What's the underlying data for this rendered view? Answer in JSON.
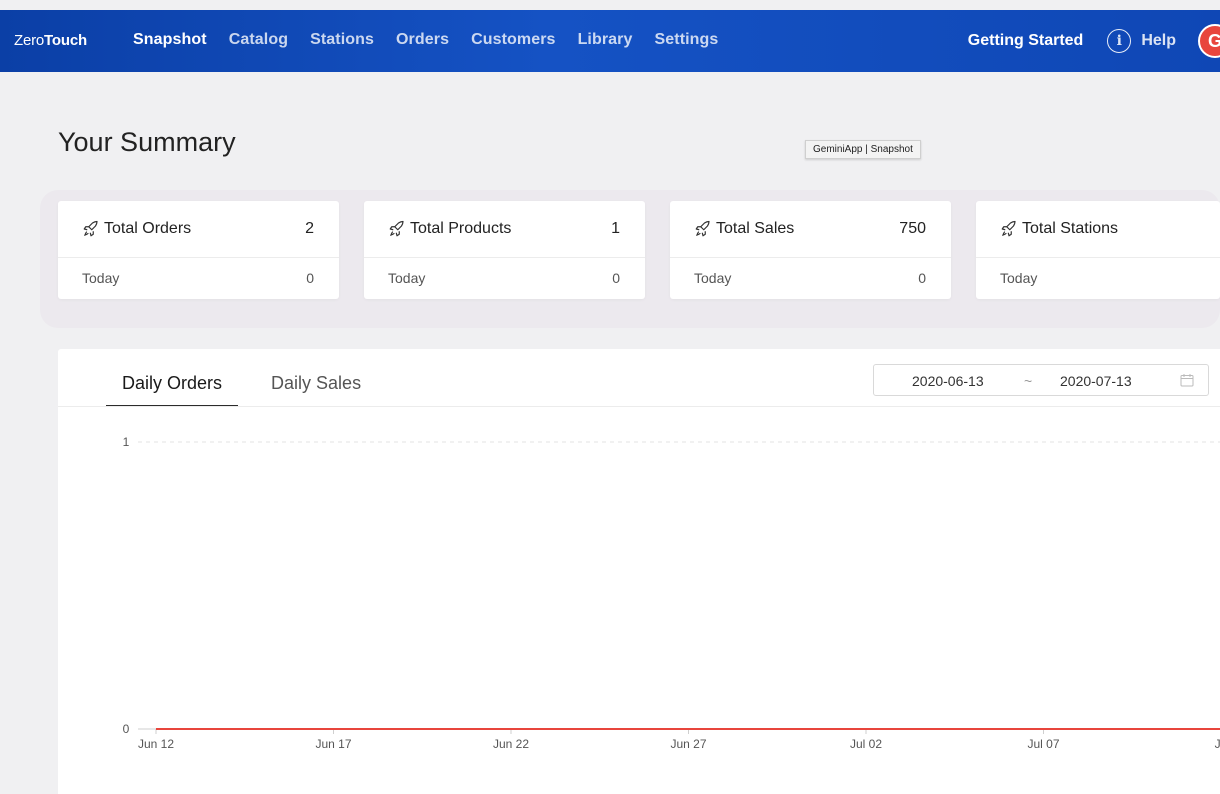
{
  "brand": {
    "part1": "Zero",
    "part2": "Touch"
  },
  "nav": {
    "items": [
      "Snapshot",
      "Catalog",
      "Stations",
      "Orders",
      "Customers",
      "Library",
      "Settings"
    ],
    "active": "Snapshot",
    "getting_started": "Getting Started",
    "help": "Help",
    "help_glyph": "i",
    "avatar_letter": "G"
  },
  "page": {
    "title": "Your Summary",
    "tooltip": "GeminiApp | Snapshot"
  },
  "cards": [
    {
      "title": "Total Orders",
      "value": "2",
      "sub_label": "Today",
      "sub_value": "0"
    },
    {
      "title": "Total Products",
      "value": "1",
      "sub_label": "Today",
      "sub_value": "0"
    },
    {
      "title": "Total Sales",
      "value": "750",
      "sub_label": "Today",
      "sub_value": "0"
    },
    {
      "title": "Total Stations",
      "value": "",
      "sub_label": "Today",
      "sub_value": ""
    }
  ],
  "tabs": [
    "Daily Orders",
    "Daily Sales"
  ],
  "active_tab": "Daily Orders",
  "date_range": {
    "start": "2020-06-13",
    "separator": "~",
    "end": "2020-07-13"
  },
  "colors": {
    "nav_bg": "#1552c4",
    "series_line": "#e8453c",
    "avatar": "#e8453c"
  },
  "chart_data": {
    "type": "line",
    "x": [
      "Jun 12",
      "Jun 17",
      "Jun 22",
      "Jun 27",
      "Jul 02",
      "Jul 07",
      "Ju"
    ],
    "y_ticks": [
      "0",
      "1"
    ],
    "ylim": [
      0,
      1
    ],
    "series": [
      {
        "values": [
          0,
          0,
          0,
          0,
          0,
          0,
          0
        ],
        "color": "#e8453c"
      }
    ],
    "grid": true
  }
}
